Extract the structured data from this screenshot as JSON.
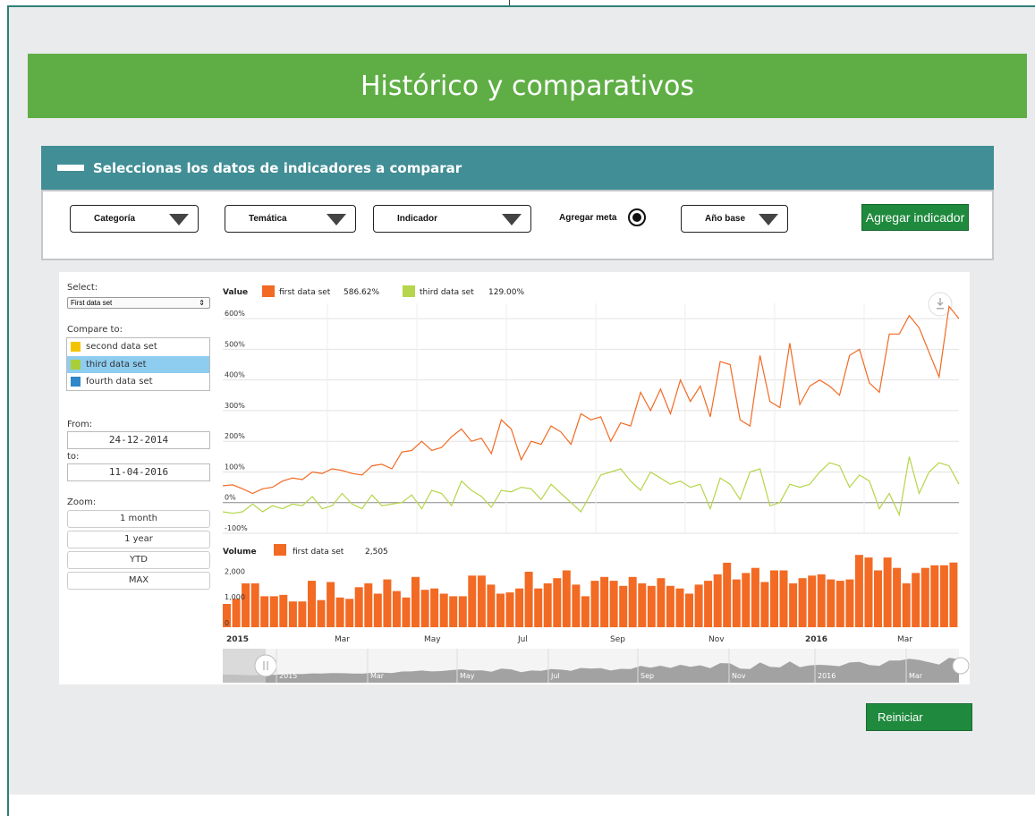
{
  "page": {
    "title": "Histórico y comparativos"
  },
  "section": {
    "header": "Seleccionas los datos de indicadores a comparar"
  },
  "controls": {
    "categoria": "Categoría",
    "tematica": "Temática",
    "indicador": "Indicador",
    "agregar_meta": "Agregar meta",
    "anio_base": "Año base",
    "agregar_indicador": "Agregar indicador"
  },
  "sidebar": {
    "select_label": "Select:",
    "select_value": "First data set",
    "compare_label": "Compare to:",
    "compare_items": [
      {
        "label": "second data set",
        "color": "#f5c400"
      },
      {
        "label": "third data set",
        "color": "#a9cf38",
        "active": true
      },
      {
        "label": "fourth data set",
        "color": "#2f86c8"
      }
    ],
    "from_label": "From:",
    "from_value": "24-12-2014",
    "to_label": "to:",
    "to_value": "11-04-2016",
    "zoom_label": "Zoom:",
    "zoom_options": [
      "1 month",
      "1 year",
      "YTD",
      "MAX"
    ]
  },
  "chart_data": {
    "type": "line",
    "value_panel": {
      "title": "Value",
      "legend": [
        {
          "name": "first data set",
          "value": "586.62%",
          "color": "#f26a23"
        },
        {
          "name": "third data set",
          "value": "129.00%",
          "color": "#b5d64a"
        }
      ],
      "y_ticks": [
        "600%",
        "500%",
        "400%",
        "300%",
        "200%",
        "100%",
        "0%",
        "-100%"
      ],
      "ylim": [
        -100,
        650
      ],
      "series": [
        {
          "name": "first data set",
          "color": "#f26a23",
          "values": [
            55,
            58,
            45,
            30,
            45,
            50,
            70,
            80,
            75,
            100,
            95,
            110,
            105,
            95,
            90,
            120,
            125,
            110,
            165,
            170,
            200,
            170,
            180,
            215,
            240,
            200,
            210,
            160,
            270,
            240,
            140,
            200,
            190,
            250,
            230,
            190,
            290,
            270,
            280,
            200,
            260,
            250,
            360,
            300,
            370,
            290,
            400,
            330,
            380,
            280,
            460,
            450,
            270,
            250,
            480,
            330,
            310,
            520,
            320,
            380,
            400,
            380,
            350,
            480,
            500,
            390,
            360,
            550,
            550,
            610,
            570,
            490,
            410,
            640,
            600
          ]
        },
        {
          "name": "third data set",
          "color": "#b5d64a",
          "values": [
            -30,
            -35,
            -30,
            -5,
            -30,
            -10,
            -20,
            -5,
            -10,
            20,
            -20,
            -10,
            30,
            -5,
            -20,
            25,
            -10,
            -5,
            0,
            25,
            -20,
            40,
            30,
            -10,
            70,
            40,
            20,
            -15,
            40,
            35,
            50,
            45,
            10,
            60,
            30,
            0,
            -30,
            30,
            90,
            100,
            110,
            70,
            40,
            100,
            80,
            60,
            70,
            50,
            60,
            -20,
            80,
            60,
            10,
            100,
            110,
            -10,
            0,
            60,
            50,
            60,
            100,
            130,
            120,
            50,
            90,
            70,
            -20,
            30,
            -40,
            150,
            30,
            100,
            130,
            120,
            60
          ]
        }
      ]
    },
    "volume_panel": {
      "title": "Volume",
      "legend": [
        {
          "name": "first data set",
          "value": "2,505",
          "color": "#f26a23"
        }
      ],
      "y_ticks": [
        "2,000",
        "1,000",
        "0"
      ],
      "ylim": [
        0,
        2600
      ],
      "values": [
        900,
        1100,
        1700,
        1700,
        1200,
        1200,
        1250,
        1000,
        1000,
        1800,
        1050,
        1750,
        1150,
        1100,
        1550,
        1700,
        1300,
        1850,
        1400,
        1150,
        1950,
        1450,
        1500,
        1300,
        1200,
        1200,
        2000,
        2000,
        1650,
        1300,
        1350,
        1500,
        2150,
        1500,
        1700,
        1900,
        2200,
        1650,
        1200,
        1800,
        1950,
        1800,
        1600,
        1950,
        1700,
        1600,
        1900,
        1600,
        1500,
        1300,
        1650,
        1800,
        2050,
        2500,
        1850,
        2100,
        2300,
        1750,
        2200,
        2200,
        1700,
        1900,
        2000,
        2050,
        1850,
        1800,
        1850,
        2800,
        2700,
        2200,
        2700,
        2300,
        1700,
        2100,
        2300,
        2400,
        2400,
        2505
      ]
    },
    "x_ticks": [
      "2015",
      "Mar",
      "May",
      "Jul",
      "Sep",
      "Nov",
      "2016",
      "Mar"
    ],
    "navigator_labels": [
      "2015",
      "Mar",
      "May",
      "Jul",
      "Sep",
      "Nov",
      "2016",
      "Mar"
    ],
    "grid": true
  },
  "actions": {
    "reset": "Reiniciar"
  }
}
